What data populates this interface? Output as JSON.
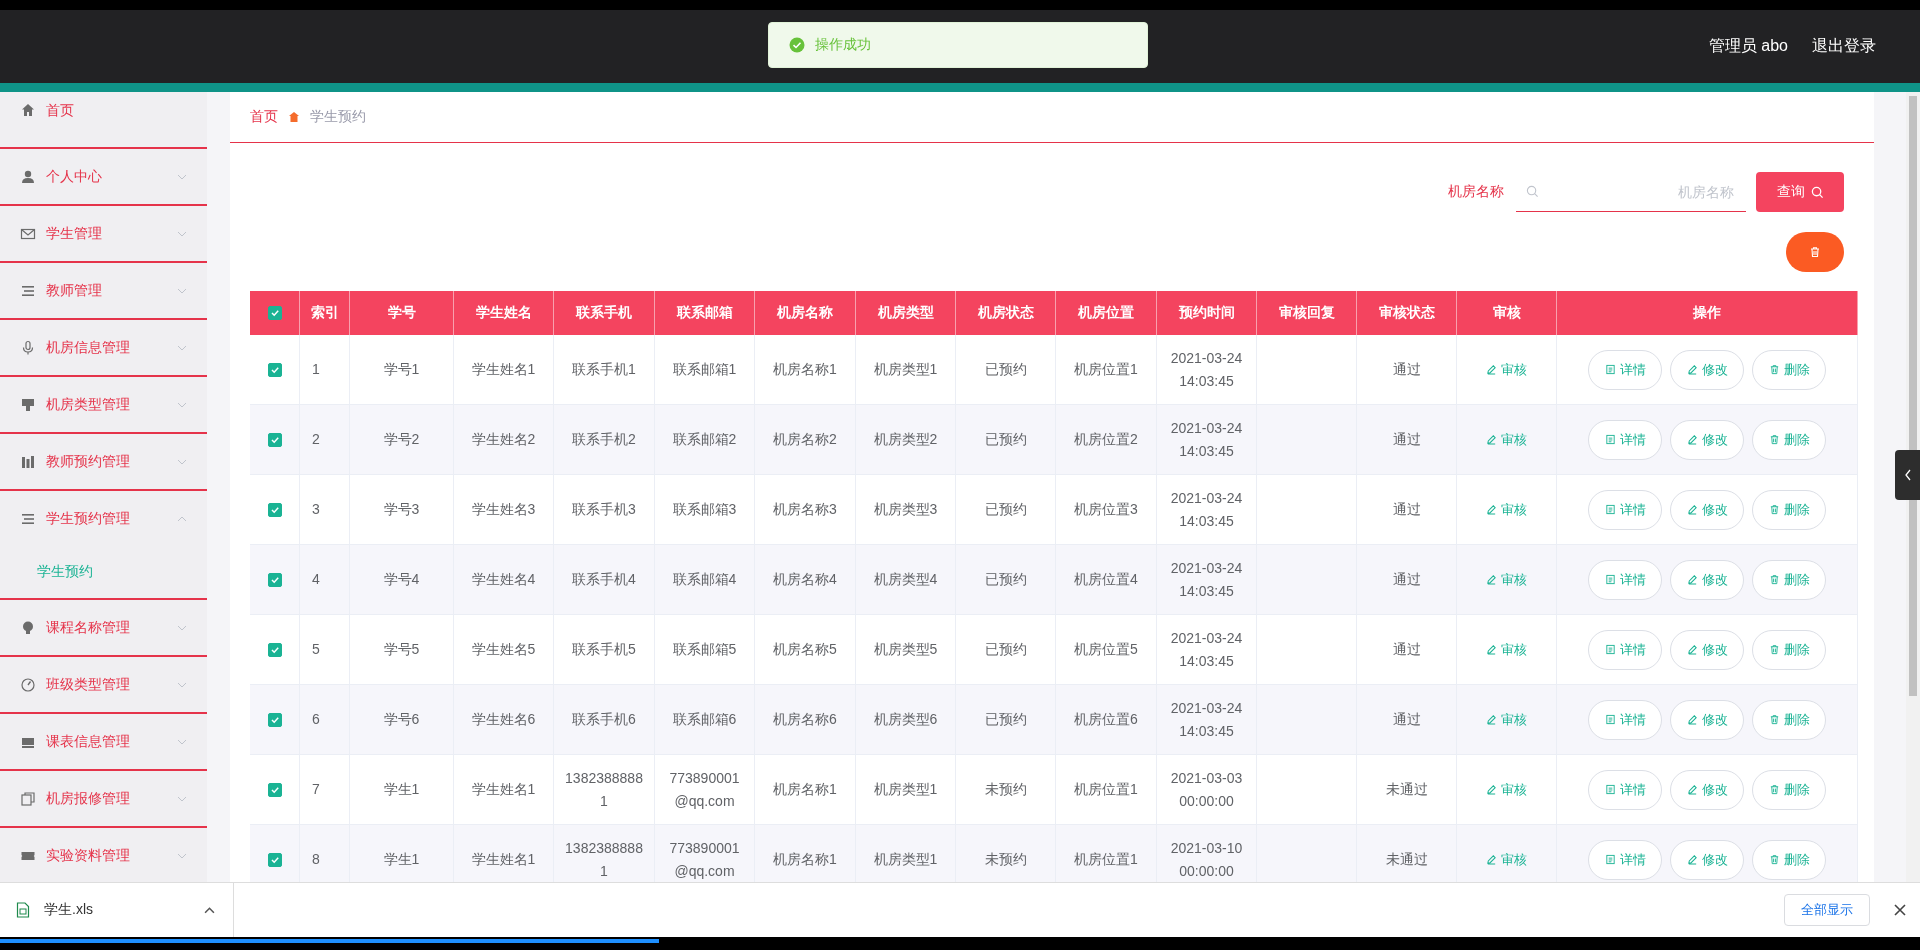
{
  "toast": {
    "text": "操作成功"
  },
  "header": {
    "user": "管理员 abo",
    "logout": "退出登录"
  },
  "sidebar": {
    "items": [
      {
        "label": "首页",
        "has_arrow": false
      },
      {
        "label": "个人中心",
        "expanded": false,
        "has_arrow": true
      },
      {
        "label": "学生管理",
        "expanded": false,
        "has_arrow": true
      },
      {
        "label": "教师管理",
        "expanded": false,
        "has_arrow": true
      },
      {
        "label": "机房信息管理",
        "expanded": false,
        "has_arrow": true
      },
      {
        "label": "机房类型管理",
        "expanded": false,
        "has_arrow": true
      },
      {
        "label": "教师预约管理",
        "expanded": false,
        "has_arrow": true
      },
      {
        "label": "学生预约管理",
        "expanded": true,
        "has_arrow": true,
        "children": [
          {
            "label": "学生预约",
            "selected": true
          }
        ]
      },
      {
        "label": "课程名称管理",
        "expanded": false,
        "has_arrow": true
      },
      {
        "label": "班级类型管理",
        "expanded": false,
        "has_arrow": true
      },
      {
        "label": "课表信息管理",
        "expanded": false,
        "has_arrow": true
      },
      {
        "label": "机房报修管理",
        "expanded": false,
        "has_arrow": true
      },
      {
        "label": "实验资料管理",
        "expanded": false,
        "has_arrow": true
      }
    ]
  },
  "breadcrumb": [
    "首页",
    "学生预约"
  ],
  "search": {
    "label": "机房名称",
    "placeholder": "机房名称",
    "button": "查询"
  },
  "table": {
    "all_checked": true,
    "columns": [
      "索引",
      "学号",
      "学生姓名",
      "联系手机",
      "联系邮箱",
      "机房名称",
      "机房类型",
      "机房状态",
      "机房位置",
      "预约时间",
      "审核回复",
      "审核状态",
      "审核",
      "操作"
    ],
    "rows": [
      {
        "checked": true,
        "cells": [
          "1",
          "学号1",
          "学生姓名1",
          "联系手机1",
          "联系邮箱1",
          "机房名称1",
          "机房类型1",
          "已预约",
          "机房位置1",
          "2021-03-24 14:03:45",
          "",
          "通过"
        ],
        "review": "审核",
        "actions": [
          "详情",
          "修改",
          "删除"
        ]
      },
      {
        "checked": true,
        "cells": [
          "2",
          "学号2",
          "学生姓名2",
          "联系手机2",
          "联系邮箱2",
          "机房名称2",
          "机房类型2",
          "已预约",
          "机房位置2",
          "2021-03-24 14:03:45",
          "",
          "通过"
        ],
        "review": "审核",
        "actions": [
          "详情",
          "修改",
          "删除"
        ]
      },
      {
        "checked": true,
        "cells": [
          "3",
          "学号3",
          "学生姓名3",
          "联系手机3",
          "联系邮箱3",
          "机房名称3",
          "机房类型3",
          "已预约",
          "机房位置3",
          "2021-03-24 14:03:45",
          "",
          "通过"
        ],
        "review": "审核",
        "actions": [
          "详情",
          "修改",
          "删除"
        ]
      },
      {
        "checked": true,
        "cells": [
          "4",
          "学号4",
          "学生姓名4",
          "联系手机4",
          "联系邮箱4",
          "机房名称4",
          "机房类型4",
          "已预约",
          "机房位置4",
          "2021-03-24 14:03:45",
          "",
          "通过"
        ],
        "review": "审核",
        "actions": [
          "详情",
          "修改",
          "删除"
        ]
      },
      {
        "checked": true,
        "cells": [
          "5",
          "学号5",
          "学生姓名5",
          "联系手机5",
          "联系邮箱5",
          "机房名称5",
          "机房类型5",
          "已预约",
          "机房位置5",
          "2021-03-24 14:03:45",
          "",
          "通过"
        ],
        "review": "审核",
        "actions": [
          "详情",
          "修改",
          "删除"
        ]
      },
      {
        "checked": true,
        "cells": [
          "6",
          "学号6",
          "学生姓名6",
          "联系手机6",
          "联系邮箱6",
          "机房名称6",
          "机房类型6",
          "已预约",
          "机房位置6",
          "2021-03-24 14:03:45",
          "",
          "通过"
        ],
        "review": "审核",
        "actions": [
          "详情",
          "修改",
          "删除"
        ]
      },
      {
        "checked": true,
        "cells": [
          "7",
          "学生1",
          "学生姓名1",
          "13823888881",
          "773890001@qq.com",
          "机房名称1",
          "机房类型1",
          "未预约",
          "机房位置1",
          "2021-03-03 00:00:00",
          "",
          "未通过"
        ],
        "review": "审核",
        "actions": [
          "详情",
          "修改",
          "删除"
        ]
      },
      {
        "checked": true,
        "cells": [
          "8",
          "学生1",
          "学生姓名1",
          "13823888881",
          "773890001@qq.com",
          "机房名称1",
          "机房类型1",
          "未预约",
          "机房位置1",
          "2021-03-10 00:00:00",
          "",
          "未通过"
        ],
        "review": "审核",
        "actions": [
          "详情",
          "修改",
          "删除"
        ]
      }
    ]
  },
  "downloads": {
    "file": "学生.xls",
    "show_all": "全部显示"
  },
  "video_progress": {
    "level": 0.343
  }
}
